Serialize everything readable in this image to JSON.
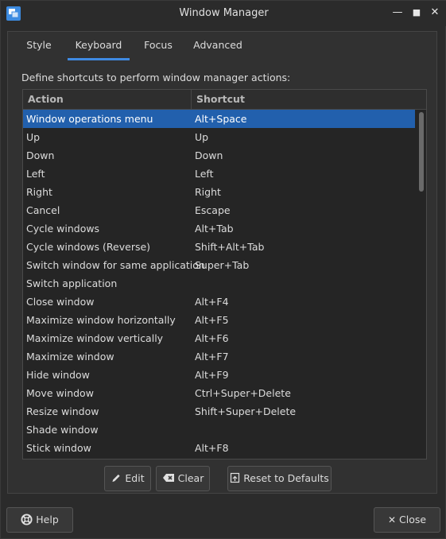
{
  "window": {
    "title": "Window Manager",
    "minimize_glyph": "—",
    "maximize_glyph": "■",
    "close_glyph": "✕"
  },
  "tabs": [
    {
      "label": "Style"
    },
    {
      "label": "Keyboard",
      "active": true
    },
    {
      "label": "Focus"
    },
    {
      "label": "Advanced"
    }
  ],
  "description": "Define shortcuts to perform window manager actions:",
  "table": {
    "headers": {
      "action": "Action",
      "shortcut": "Shortcut"
    },
    "rows": [
      {
        "action": "Window operations menu",
        "shortcut": "Alt+Space",
        "selected": true
      },
      {
        "action": "Up",
        "shortcut": "Up"
      },
      {
        "action": "Down",
        "shortcut": "Down"
      },
      {
        "action": "Left",
        "shortcut": "Left"
      },
      {
        "action": "Right",
        "shortcut": "Right"
      },
      {
        "action": "Cancel",
        "shortcut": "Escape"
      },
      {
        "action": "Cycle windows",
        "shortcut": "Alt+Tab"
      },
      {
        "action": "Cycle windows (Reverse)",
        "shortcut": "Shift+Alt+Tab"
      },
      {
        "action": "Switch window for same application",
        "shortcut": "Super+Tab"
      },
      {
        "action": "Switch application",
        "shortcut": ""
      },
      {
        "action": "Close window",
        "shortcut": "Alt+F4"
      },
      {
        "action": "Maximize window horizontally",
        "shortcut": "Alt+F5"
      },
      {
        "action": "Maximize window vertically",
        "shortcut": "Alt+F6"
      },
      {
        "action": "Maximize window",
        "shortcut": "Alt+F7"
      },
      {
        "action": "Hide window",
        "shortcut": "Alt+F9"
      },
      {
        "action": "Move window",
        "shortcut": "Ctrl+Super+Delete"
      },
      {
        "action": "Resize window",
        "shortcut": "Shift+Super+Delete"
      },
      {
        "action": "Shade window",
        "shortcut": ""
      },
      {
        "action": "Stick window",
        "shortcut": "Alt+F8"
      }
    ]
  },
  "buttons": {
    "edit": "Edit",
    "clear": "Clear",
    "reset": "Reset to Defaults",
    "help": "Help",
    "close": "Close"
  },
  "colors": {
    "accent": "#3f8ae2",
    "selection": "#2260ad"
  }
}
